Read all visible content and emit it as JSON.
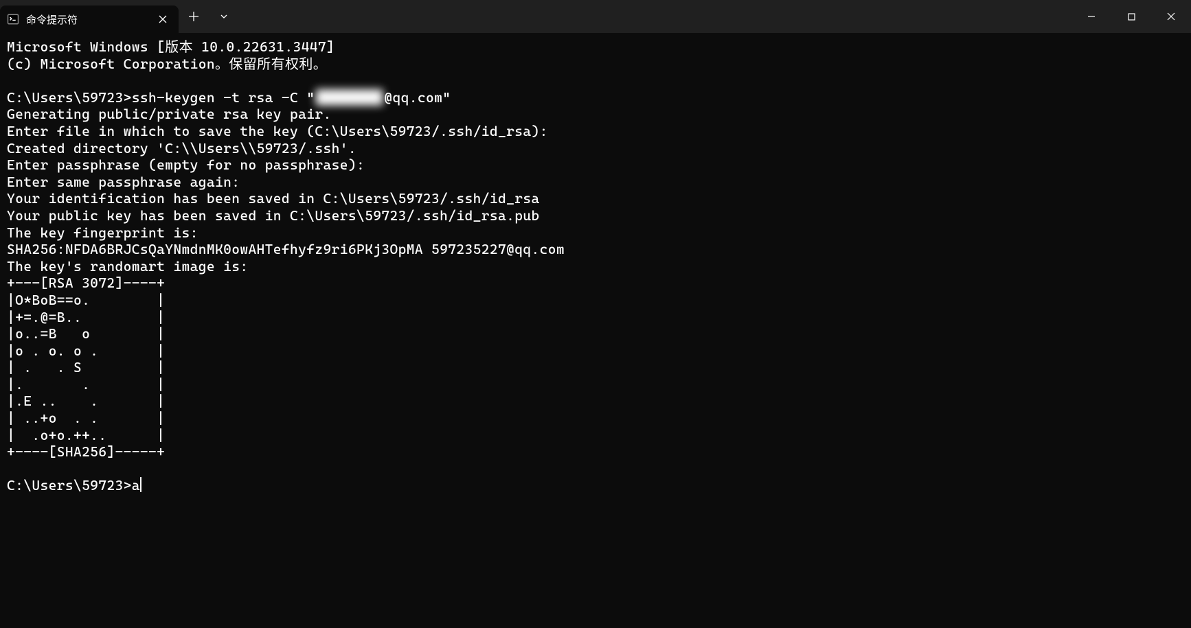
{
  "titlebar": {
    "tab": {
      "label": "命令提示符",
      "icon_name": "terminal-icon"
    },
    "newtab_tooltip": "+",
    "dropdown_tooltip": "v"
  },
  "terminal": {
    "lines": [
      "Microsoft Windows [版本 10.0.22631.3447]",
      "(c) Microsoft Corporation。保留所有权利。",
      "",
      "__CMD1__",
      "Generating public/private rsa key pair.",
      "Enter file in which to save the key (C:\\Users\\59723/.ssh/id_rsa):",
      "Created directory 'C:\\\\Users\\\\59723/.ssh'.",
      "Enter passphrase (empty for no passphrase):",
      "Enter same passphrase again:",
      "Your identification has been saved in C:\\Users\\59723/.ssh/id_rsa",
      "Your public key has been saved in C:\\Users\\59723/.ssh/id_rsa.pub",
      "The key fingerprint is:",
      "SHA256:NFDA6BRJCsQaYNmdnMK0owAHTefhyfz9ri6PKj3OpMA 597235227@qq.com",
      "The key's randomart image is:",
      "+---[RSA 3072]----+",
      "|O*BoB==o.        |",
      "|+=.@=B..         |",
      "|o..=B   o        |",
      "|o . o. o .       |",
      "| .   . S         |",
      "|.       .        |",
      "|.E ..    .       |",
      "| ..+o  . .       |",
      "|  .o+o.++..      |",
      "+----[SHA256]-----+",
      "",
      "__PROMPT__"
    ],
    "cmd1_prefix": "C:\\Users\\59723>ssh-keygen -t rsa -C \"",
    "cmd1_blurred": "████████",
    "cmd1_suffix": "@qq.com\"",
    "prompt_prefix": "C:\\Users\\59723>",
    "prompt_typed": "a"
  }
}
